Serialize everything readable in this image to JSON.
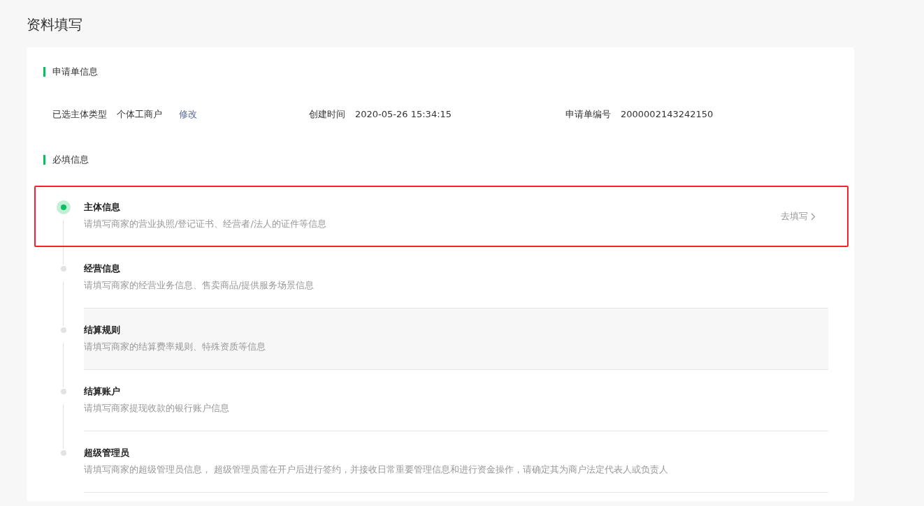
{
  "page_title": "资料填写",
  "application_section": {
    "heading": "申请单信息",
    "fields": [
      {
        "label": "已选主体类型",
        "value": "个体工商户",
        "link": "修改"
      },
      {
        "label": "创建时间",
        "value": "2020-05-26 15:34:15"
      },
      {
        "label": "申请单编号",
        "value": "2000002143242150"
      }
    ]
  },
  "required_section": {
    "heading": "必填信息",
    "steps": [
      {
        "title": "主体信息",
        "description": "请填写商家的营业执照/登记证书、经营者/法人的证件等信息",
        "selected": true,
        "hovered": false,
        "highlighted": true,
        "action": "去填写"
      },
      {
        "title": "经营信息",
        "description": "请填写商家的经营业务信息、售卖商品/提供服务场景信息",
        "selected": false,
        "hovered": false,
        "highlighted": false
      },
      {
        "title": "结算规则",
        "description": "请填写商家的结算费率规则、特殊资质等信息",
        "selected": false,
        "hovered": true,
        "highlighted": false
      },
      {
        "title": "结算账户",
        "description": "请填写商家提现收款的银行账户信息",
        "selected": false,
        "hovered": false,
        "highlighted": false
      },
      {
        "title": "超级管理员",
        "description": "请填写商家的超级管理员信息， 超级管理员需在开户后进行签约，并接收日常重要管理信息和进行资金操作，请确定其为商户法定代表人或负责人",
        "selected": false,
        "hovered": false,
        "highlighted": false
      }
    ]
  }
}
